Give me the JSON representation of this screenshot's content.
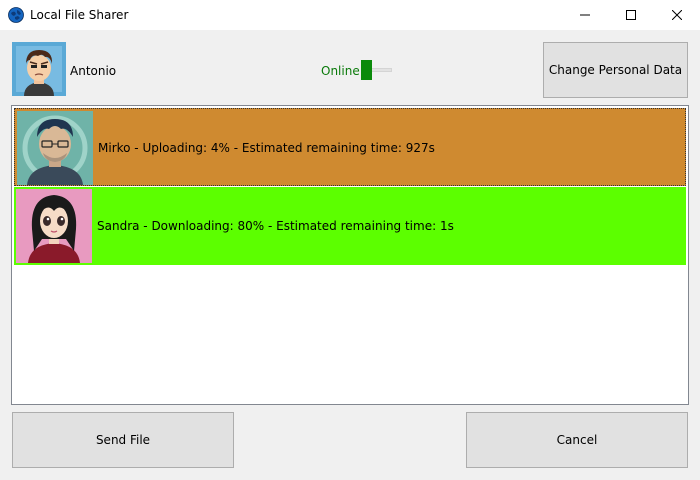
{
  "window": {
    "title": "Local File Sharer",
    "icon": "globe-icon",
    "controls": [
      "minimize-icon",
      "maximize-icon",
      "close-icon"
    ]
  },
  "header": {
    "user_name": "Antonio",
    "status_label": "Online",
    "status_on": true,
    "change_button_label": "Change Personal Data"
  },
  "transfers": [
    {
      "text": "Mirko - Uploading: 4% - Estimated remaining time: 927s",
      "color": "#cf8a30"
    },
    {
      "text": "Sandra - Downloading: 80% - Estimated remaining time: 1s",
      "color": "#5cff00"
    }
  ],
  "footer": {
    "send_label": "Send File",
    "cancel_label": "Cancel"
  },
  "colors": {
    "online": "#0b8a0b",
    "upload_row": "#cf8a30",
    "download_row": "#5cff00"
  }
}
